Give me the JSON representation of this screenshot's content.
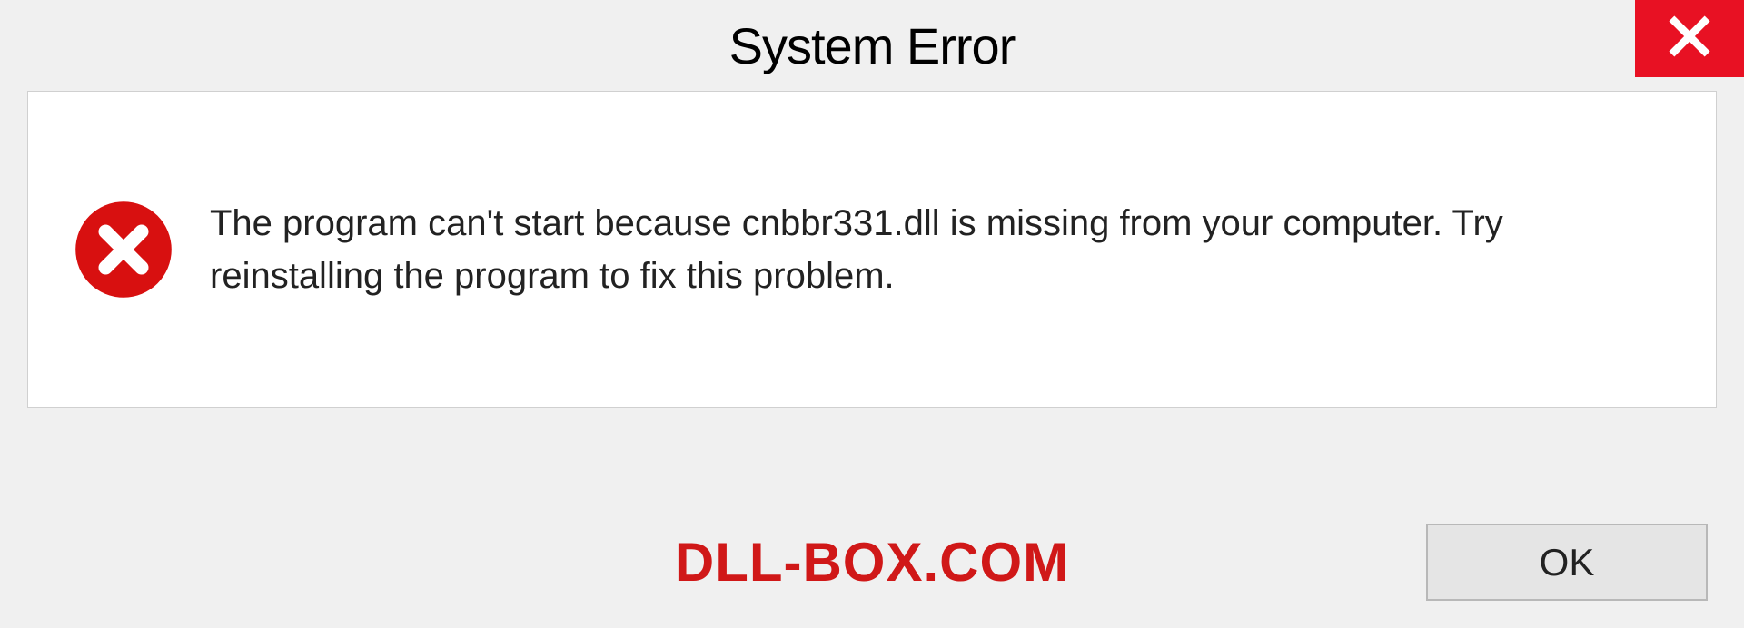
{
  "dialog": {
    "title": "System Error",
    "message": "The program can't start because cnbbr331.dll is missing from your computer. Try reinstalling the program to fix this problem.",
    "ok_label": "OK"
  },
  "watermark": "DLL-BOX.COM",
  "colors": {
    "close_button_bg": "#e81123",
    "error_icon": "#d81010",
    "watermark": "#d01818"
  }
}
